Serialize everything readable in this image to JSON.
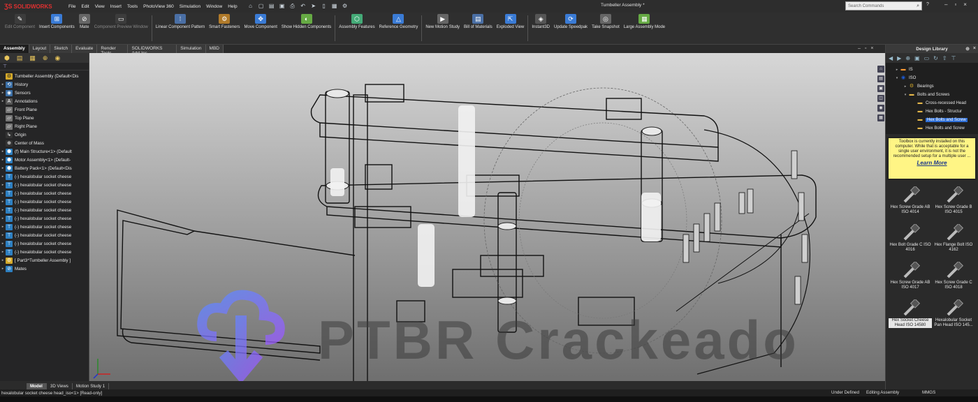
{
  "app": {
    "brand": "SOLIDWORKS",
    "doc_title": "Tumbeller Assembly *"
  },
  "menu": [
    "File",
    "Edit",
    "View",
    "Insert",
    "Tools",
    "PhotoView 360",
    "Simulation",
    "Window",
    "Help"
  ],
  "search": {
    "placeholder": "Search Commands"
  },
  "ribbon": [
    {
      "label": "Edit Component",
      "icon": "edit-component-icon",
      "disabled": true
    },
    {
      "label": "Insert Components",
      "icon": "insert-components-icon"
    },
    {
      "label": "Mate",
      "icon": "mate-icon"
    },
    {
      "label": "Component Preview Window",
      "icon": "preview-window-icon",
      "disabled": true
    },
    {
      "label": "Linear Component Pattern",
      "icon": "pattern-icon"
    },
    {
      "label": "Smart Fasteners",
      "icon": "smart-fasteners-icon"
    },
    {
      "label": "Move Component",
      "icon": "move-component-icon"
    },
    {
      "label": "Show Hidden Components",
      "icon": "show-hidden-icon"
    },
    {
      "label": "Assembly Features",
      "icon": "assembly-features-icon"
    },
    {
      "label": "Reference Geometry",
      "icon": "reference-geometry-icon"
    },
    {
      "label": "New Motion Study",
      "icon": "motion-study-icon"
    },
    {
      "label": "Bill of Materials",
      "icon": "bom-icon"
    },
    {
      "label": "Exploded View",
      "icon": "exploded-view-icon"
    },
    {
      "label": "Instant3D",
      "icon": "instant3d-icon"
    },
    {
      "label": "Update Speedpak",
      "icon": "speedpak-icon"
    },
    {
      "label": "Take Snapshot",
      "icon": "snapshot-icon"
    },
    {
      "label": "Large Assembly Mode",
      "icon": "large-assembly-icon"
    }
  ],
  "cm_tabs": [
    "Assembly",
    "Layout",
    "Sketch",
    "Evaluate",
    "Render Tools",
    "SOLIDWORKS Add-Ins",
    "Simulation",
    "MBD"
  ],
  "tree": {
    "root": "Tumbeller Assembly  (Default<Dis",
    "items": [
      {
        "label": "History",
        "icon": "history-icon"
      },
      {
        "label": "Sensors",
        "icon": "sensors-icon"
      },
      {
        "label": "Annotations",
        "icon": "annotations-icon"
      },
      {
        "label": "Front Plane",
        "icon": "plane-icon"
      },
      {
        "label": "Top Plane",
        "icon": "plane-icon"
      },
      {
        "label": "Right Plane",
        "icon": "plane-icon"
      },
      {
        "label": "Origin",
        "icon": "origin-icon"
      },
      {
        "label": "Center of Mass",
        "icon": "center-of-mass-icon"
      },
      {
        "label": "(f) Main Structure<1> (Default",
        "icon": "part-icon"
      },
      {
        "label": "Motor Assembly<1> (Default-",
        "icon": "part-icon"
      },
      {
        "label": "Battery Pack<1> (Default<Dis",
        "icon": "part-icon"
      },
      {
        "label": "(-) hexalobular socket cheese",
        "icon": "fastener-icon"
      },
      {
        "label": "(-) hexalobular socket cheese",
        "icon": "fastener-icon"
      },
      {
        "label": "(-) hexalobular socket cheese",
        "icon": "fastener-icon"
      },
      {
        "label": "(-) hexalobular socket cheese",
        "icon": "fastener-icon"
      },
      {
        "label": "(-) hexalobular socket cheese",
        "icon": "fastener-icon"
      },
      {
        "label": "(-) hexalobular socket cheese",
        "icon": "fastener-icon"
      },
      {
        "label": "(-) hexalobular socket cheese",
        "icon": "fastener-icon"
      },
      {
        "label": "(-) hexalobular socket cheese",
        "icon": "fastener-icon"
      },
      {
        "label": "(-) hexalobular socket cheese",
        "icon": "fastener-icon"
      },
      {
        "label": "(-) hexalobular socket cheese",
        "icon": "fastener-icon"
      },
      {
        "label": "[ Part3^Tumbeller Assembly ]",
        "icon": "virtual-part-icon"
      },
      {
        "label": "Mates",
        "icon": "mates-icon"
      }
    ]
  },
  "bottom_tabs": [
    "Model",
    "3D Views",
    "Motion Study 1"
  ],
  "status": {
    "left": "hexalobular socket cheese head_iso<1> [Read-only]",
    "definition": "Under Defined",
    "mode": "Editing Assembly",
    "units": "MMGS"
  },
  "design_library": {
    "title": "Design Library",
    "tree": [
      {
        "label": "IS",
        "level": 1,
        "icon": "flag-india-icon"
      },
      {
        "label": "ISO",
        "level": 1,
        "icon": "iso-icon"
      },
      {
        "label": "Bearings",
        "level": 2,
        "icon": "bearings-icon"
      },
      {
        "label": "Bolts and Screws",
        "level": 2,
        "icon": "folder-icon"
      },
      {
        "label": "Cross-recessed Head",
        "level": 3,
        "icon": "folder-icon"
      },
      {
        "label": "Hex Bolts - Structur",
        "level": 3,
        "icon": "folder-icon"
      },
      {
        "label": "Hex Bolts and Screw",
        "level": 3,
        "icon": "folder-icon",
        "selected": true
      },
      {
        "label": "Hex Bolts and Screw",
        "level": 3,
        "icon": "folder-icon"
      }
    ],
    "notice": "Toolbox is currently installed on this computer. While that is acceptable for a single user environment, it is not the recommended setup for a multiple user ...",
    "notice_link": "Learn More",
    "items": [
      {
        "label": "Hex Screw Grade AB ISO 4014"
      },
      {
        "label": "Hex Screw Grade B ISO 4015"
      },
      {
        "label": "Hex Bolt Grade C ISO 4016"
      },
      {
        "label": "Hex Flange Bolt ISO 4162"
      },
      {
        "label": "Hex Screw Grade AB ISO 4017"
      },
      {
        "label": "Hex Screw Grade C ISO 4018"
      },
      {
        "label": "Hex Socket Cheese Head ISO 14580",
        "selected": true
      },
      {
        "label": "Hexalobular Socket Pan Head ISO 145..."
      }
    ]
  },
  "watermark": "PTBR Crackeado"
}
